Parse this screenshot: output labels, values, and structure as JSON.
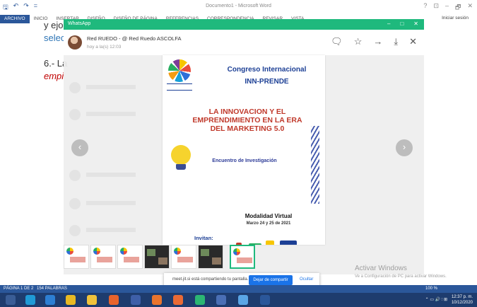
{
  "word": {
    "title": "Documento1 - Microsoft Word",
    "qat": [
      "🖫",
      "↶",
      "↷",
      "="
    ],
    "tabs": [
      "ARCHIVO",
      "INICIO",
      "INSERTAR",
      "DISEÑO",
      "DISEÑO DE PÁGINA",
      "REFERENCIAS",
      "CORRESPONDENCIA",
      "REVISAR",
      "VISTA"
    ],
    "sign_in": "Iniciar sesión",
    "window_controls": [
      "?",
      "⊡",
      "–",
      "🗗",
      "✕"
    ],
    "doc": {
      "line1": "y ejo",
      "line2": "selec",
      "line3": "6.- La",
      "line4": "empi"
    },
    "status": {
      "page": "PÁGINA 1 DE 2",
      "words": "154 PALABRAS",
      "zoom": "100 %"
    }
  },
  "whatsapp": {
    "app_title": "WhatsApp",
    "window_controls": [
      "–",
      "□",
      "✕"
    ],
    "sender": "Red RUEDO - @ Red Ruedo ASCOLFA",
    "timestamp": "hoy a la(s) 12:03",
    "actions": [
      "🗨",
      "☆",
      "→",
      "⤓",
      "✕"
    ],
    "prev_arrow": "‹",
    "next_arrow": "›"
  },
  "poster": {
    "congreso": "Congreso Internacional",
    "innprende": "INN-PRENDE",
    "title": "LA INNOVACION Y EL EMPRENDIMIENTO EN LA ERA DEL MARKETING 5.0",
    "encuentro": "Encuentro de Investigación",
    "modalidad": "Modalidad Virtual",
    "fechas": "Marzo 24 y 25 de 2021",
    "invitan": "Invitan:"
  },
  "share": {
    "text": "meet.jit.si está compartiendo tu pantalla.",
    "stop": "Dejar de compartir",
    "hide": "Ocultar"
  },
  "activate": {
    "title": "Activar Windows",
    "subtitle": "Ve a Configuración de PC para activar Windows."
  },
  "taskbar": {
    "time": "12:37 p. m.",
    "date": "10/12/2020",
    "tray": "⌃ ▭ 🔊 ⫶ ⊞"
  },
  "colors": {
    "whatsapp_green": "#1fb97d",
    "word_blue": "#2b579a",
    "taskbar": "#1e3c6e"
  }
}
